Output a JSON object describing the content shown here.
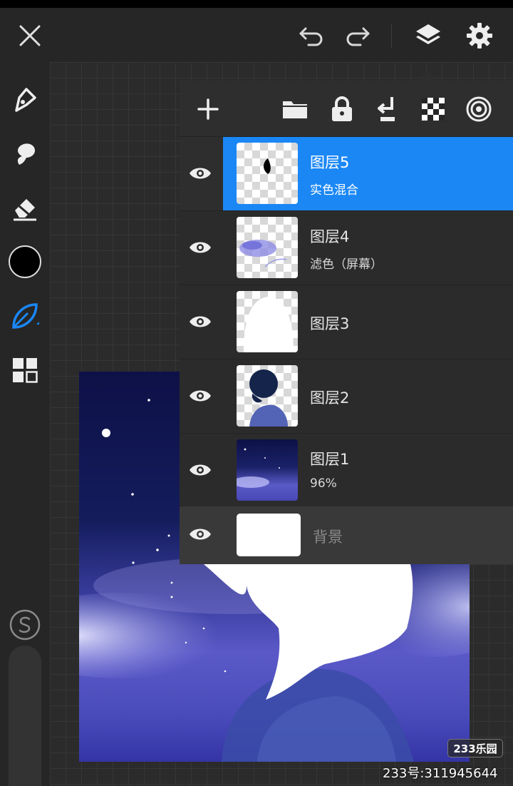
{
  "icons": {
    "close": "close-icon",
    "undo": "undo-icon",
    "redo": "redo-icon",
    "layers": "layers-icon",
    "settings": "gear-icon"
  },
  "tools": [
    "pen-icon",
    "smudge-icon",
    "eraser-icon",
    "color-swatch",
    "leaf-brush-icon",
    "grid-icon",
    "s-icon"
  ],
  "layer_actions": [
    "add-icon",
    "folder-icon",
    "lock-icon",
    "merge-down-icon",
    "checker-icon",
    "target-icon"
  ],
  "colors": {
    "accent": "#1a87f5",
    "panel": "#2e2e2e",
    "current_color": "#000000"
  },
  "layers": [
    {
      "name": "图层5",
      "sub": "实色混合",
      "selected": true
    },
    {
      "name": "图层4",
      "sub": "滤色（屏幕）",
      "selected": false
    },
    {
      "name": "图层3",
      "sub": "",
      "selected": false
    },
    {
      "name": "图层2",
      "sub": "",
      "selected": false
    },
    {
      "name": "图层1",
      "sub": "96%",
      "selected": false
    }
  ],
  "background_layer": {
    "name": "背景"
  },
  "watermark": {
    "badge": "233乐园",
    "id_text": "233号:311945644"
  }
}
